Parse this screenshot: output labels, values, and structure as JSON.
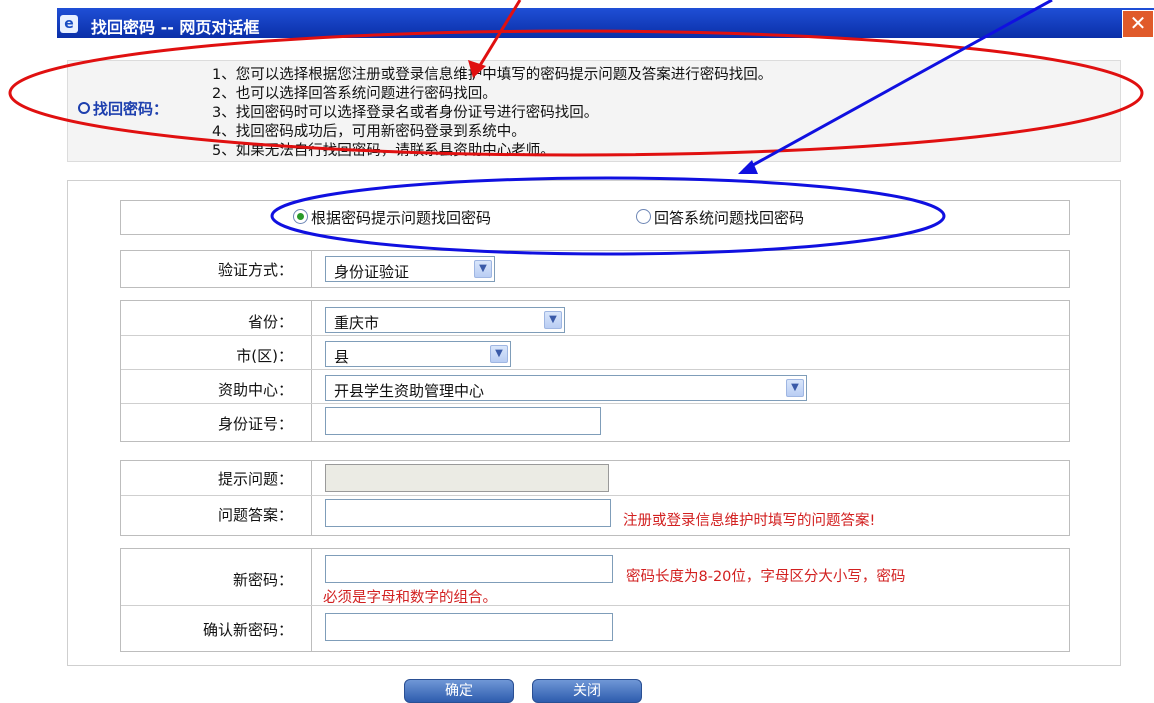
{
  "window": {
    "title": "找回密码 -- 网页对话框",
    "close_glyph": "✕",
    "ie_glyph": "e"
  },
  "info": {
    "label": "找回密码：",
    "lines": [
      "1、您可以选择根据您注册或登录信息维护中填写的密码提示问题及答案进行密码找回。",
      "2、也可以选择回答系统问题进行密码找回。",
      "3、找回密码时可以选择登录名或者身份证号进行密码找回。",
      "4、找回密码成功后，可用新密码登录到系统中。",
      "5、如果无法自行找回密码，请联系县资助中心老师。"
    ]
  },
  "mode": {
    "option1": "根据密码提示问题找回密码",
    "option2": "回答系统问题找回密码",
    "selected": "option1"
  },
  "verify": {
    "label": "验证方式：",
    "value": "身份证验证"
  },
  "location": {
    "province_label": "省份：",
    "province_value": "重庆市",
    "city_label": "市(区)：",
    "city_value": "县",
    "center_label": "资助中心：",
    "center_value": "开县学生资助管理中心",
    "id_label": "身份证号：",
    "id_value": ""
  },
  "question": {
    "prompt_label": "提示问题：",
    "prompt_value": "",
    "answer_label": "问题答案：",
    "answer_value": "",
    "answer_hint": "注册或登录信息维护时填写的问题答案!"
  },
  "password": {
    "new_label": "新密码：",
    "new_hint_line1": "密码长度为8-20位，字母区分大小写，密码",
    "new_hint_line2": "必须是字母和数字的组合。",
    "confirm_label": "确认新密码："
  },
  "buttons": {
    "ok": "确定",
    "close": "关闭"
  },
  "colors": {
    "annotation_red": "#e01010",
    "annotation_blue": "#1010e0",
    "hint_red": "#d22020",
    "title_blue": "#1f4fd6"
  }
}
